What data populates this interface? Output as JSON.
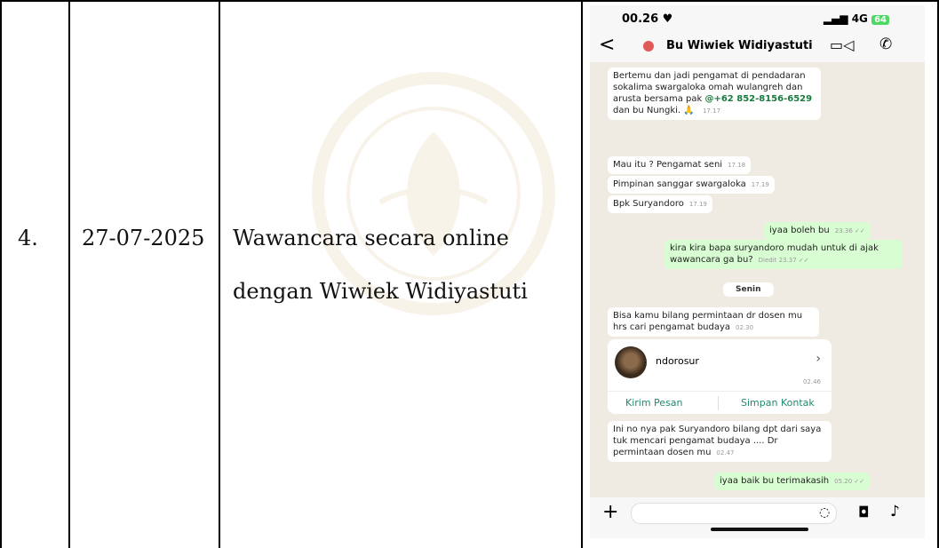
{
  "table": {
    "number": "4.",
    "date": "27-07-2025",
    "activity_line1": "Wawancara secara online",
    "activity_line2": "dengan Wiwiek Widiyastuti"
  },
  "phone": {
    "status": {
      "time": "00.26 ♥",
      "network": "4G",
      "battery": "64"
    },
    "header": {
      "contact_name": "Bu Wiwiek Widiyastuti",
      "back": "<"
    },
    "messages": [
      {
        "dir": "in",
        "text": "Bertemu dan jadi pengamat di pendadaran sokalima swargaloka omah wulangreh dan arusta bersama pak",
        "link": "@+62 852-8156-6529",
        "text2": "dan bu Nungki. 🙏",
        "time": "17.17"
      },
      {
        "dir": "in",
        "text": "Mau itu ? Pengamat seni",
        "time": "17.18"
      },
      {
        "dir": "in",
        "text": "Pimpinan sanggar swargaloka",
        "time": "17.19"
      },
      {
        "dir": "in",
        "text": "Bpk Suryandoro",
        "time": "17.19"
      },
      {
        "dir": "out",
        "text": "iyaa boleh bu",
        "time": "23.36 ✓✓"
      },
      {
        "dir": "out",
        "text": "kira kira bapa suryandoro mudah untuk di ajak wawancara ga bu?",
        "time": "Diedit 23.37 ✓✓"
      },
      {
        "dir": "in",
        "text": "Bisa kamu bilang permintaan dr dosen mu hrs cari pengamat budaya",
        "time": "02.30"
      },
      {
        "dir": "in",
        "text": "Ini no nya pak Suryandoro bilang dpt dari saya tuk mencari pengamat budaya .... Dr permintaan  dosen mu",
        "time": "02.47"
      },
      {
        "dir": "out",
        "text": "iyaa baik bu terimakasih",
        "time": "05.20 ✓✓"
      }
    ],
    "day_separator": "Senin",
    "contact_card": {
      "name": "ndorosur",
      "time": "02.46",
      "button_send": "Kirim Pesan",
      "button_save": "Simpan Kontak"
    }
  }
}
